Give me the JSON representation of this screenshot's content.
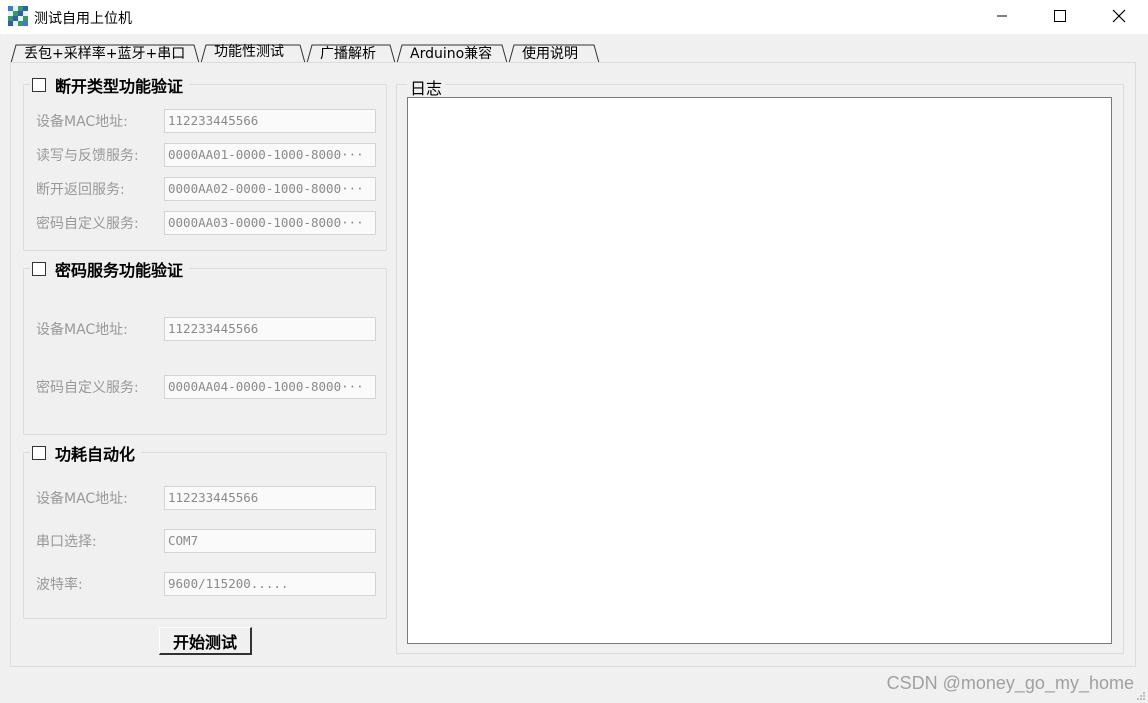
{
  "window": {
    "title": "测试自用上位机",
    "icon": "app-grid-icon",
    "controls": [
      "minimize-icon",
      "maximize-icon",
      "close-icon"
    ]
  },
  "tabs": [
    {
      "label": "丢包+采样率+蓝牙+串口",
      "active": false
    },
    {
      "label": "功能性测试",
      "active": true
    },
    {
      "label": "广播解析",
      "active": false
    },
    {
      "label": "Arduino兼容",
      "active": false
    },
    {
      "label": "使用说明",
      "active": false
    }
  ],
  "groups": {
    "disconnect": {
      "title": "断开类型功能验证",
      "checked": false,
      "mac_label": "设备MAC地址:",
      "mac_value": "112233445566",
      "rw_label": "读写与反馈服务:",
      "rw_value": "0000AA01-0000-1000-8000···",
      "dc_label": "断开返回服务:",
      "dc_value": "0000AA02-0000-1000-8000···",
      "pw_label": "密码自定义服务:",
      "pw_value": "0000AA03-0000-1000-8000···"
    },
    "password": {
      "title": "密码服务功能验证",
      "checked": false,
      "mac_label": "设备MAC地址:",
      "mac_value": "112233445566",
      "pw_label": "密码自定义服务:",
      "pw_value": "0000AA04-0000-1000-8000···"
    },
    "power": {
      "title": "功耗自动化",
      "checked": false,
      "mac_label": "设备MAC地址:",
      "mac_value": "112233445566",
      "port_label": "串口选择:",
      "port_value": "COM7",
      "baud_label": "波特率:",
      "baud_value": "9600/115200....."
    }
  },
  "start_button": "开始测试",
  "log": {
    "title": "日志",
    "content": ""
  },
  "watermark": "CSDN @money_go_my_home",
  "colors": {
    "window_bg": "#f0f0f0",
    "titlebar_bg": "#ffffff",
    "disabled_text": "#999999",
    "field_border": "#d4d4d4"
  }
}
